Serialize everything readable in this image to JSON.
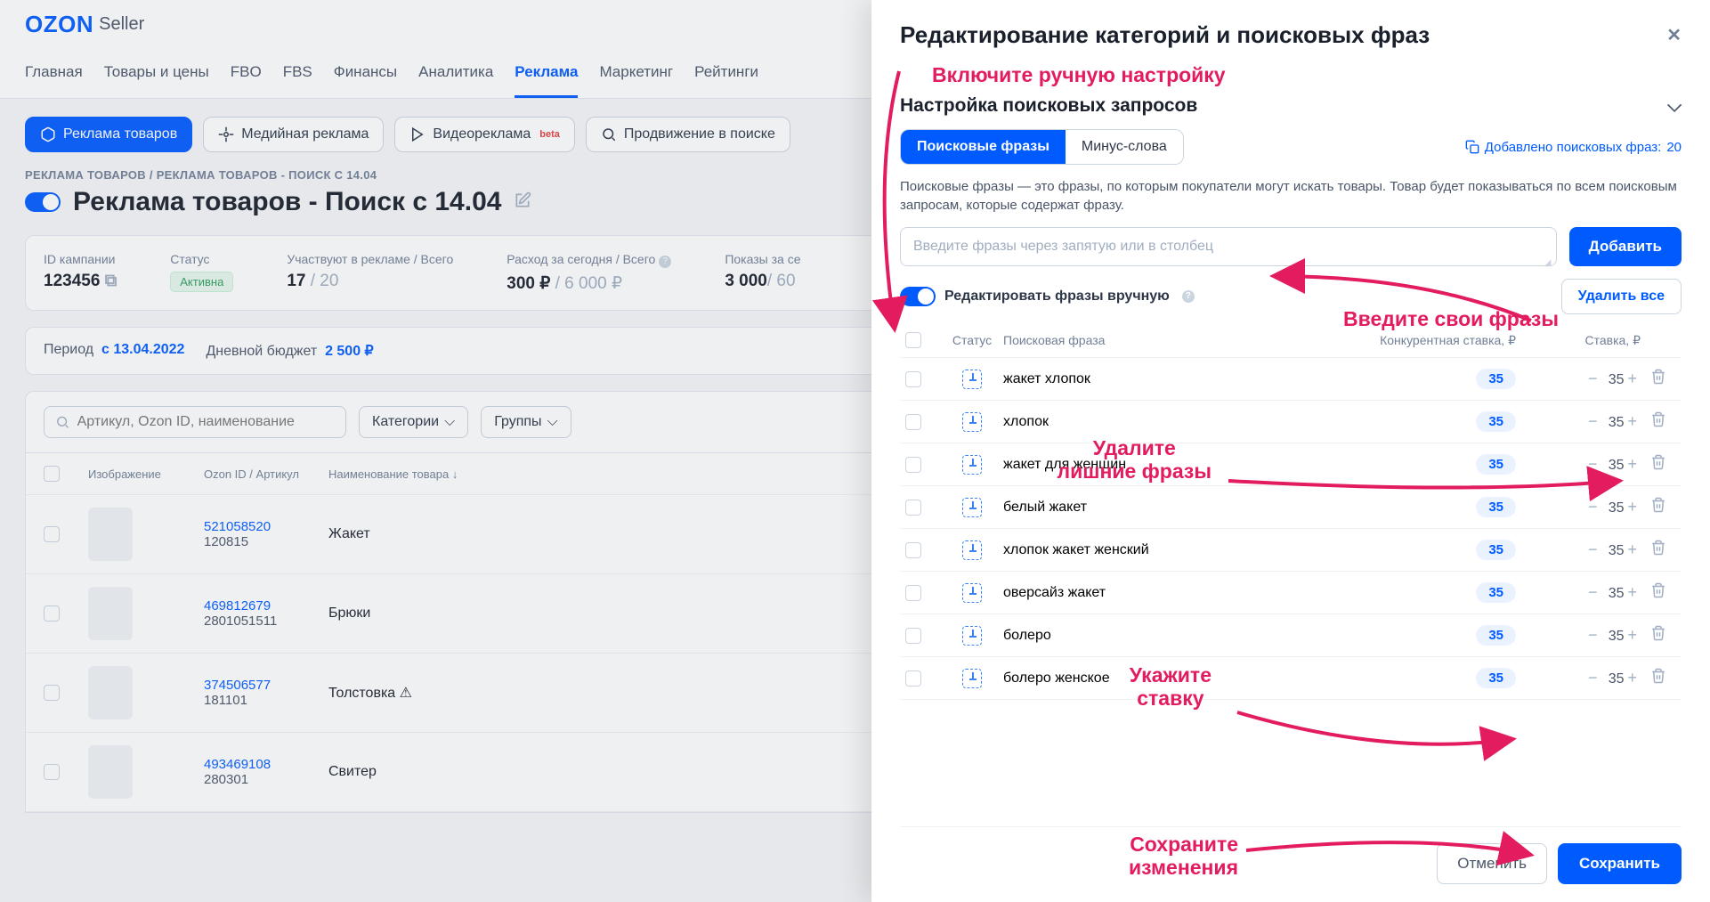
{
  "header": {
    "logo": "OZON",
    "logoSuffix": "Seller"
  },
  "nav": {
    "items": [
      "Главная",
      "Товары и цены",
      "FBO",
      "FBS",
      "Финансы",
      "Аналитика",
      "Реклама",
      "Маркетинг",
      "Рейтинги"
    ],
    "activeIndex": 6
  },
  "subnav": {
    "primary": "Реклама товаров",
    "items": [
      "Медийная реклама",
      "Видеореклама",
      "Продвижение в поиске"
    ],
    "beta": "beta"
  },
  "breadcrumb": "РЕКЛАМА ТОВАРОВ  /  РЕКЛАМА ТОВАРОВ - ПОИСК С 14.04",
  "title": "Реклама товаров - Поиск с 14.04",
  "stats": {
    "campaign": {
      "label": "ID кампании",
      "value": "123456"
    },
    "status": {
      "label": "Статус",
      "badge": "Активна"
    },
    "participation": {
      "label": "Участвуют в рекламе / Всего",
      "value": "17",
      "total": "/ 20"
    },
    "spend": {
      "label": "Расход за сегодня / Всего",
      "value": "300 ₽",
      "total": "/ 6 000 ₽"
    },
    "impressions": {
      "label": "Показы за се",
      "value": "3 000",
      "total": "/ 60"
    }
  },
  "period": {
    "labelPeriod": "Период",
    "valuePeriod": "с 13.04.2022",
    "labelBudget": "Дневной бюджет",
    "valueBudget": "2 500 ₽"
  },
  "filters": {
    "searchPlaceholder": "Артикул, Ozon ID, наименование",
    "categories": "Категории",
    "groups": "Группы"
  },
  "tableHead": {
    "image": "Изображение",
    "ozonId": "Ozon ID / Артикул",
    "name": "Наименование товара"
  },
  "products": [
    {
      "ozonId": "521058520",
      "article": "120815",
      "name": "Жакет"
    },
    {
      "ozonId": "469812679",
      "article": "2801051511",
      "name": "Брюки"
    },
    {
      "ozonId": "374506577",
      "article": "181101",
      "name": "Толстовка ⚠"
    },
    {
      "ozonId": "493469108",
      "article": "280301",
      "name": "Свитер"
    }
  ],
  "panel": {
    "title": "Редактирование категорий и поисковых фраз",
    "sectionTitle": "Настройка поисковых запросов",
    "tabs": {
      "active": "Поисковые фразы",
      "inactive": "Минус-слова"
    },
    "addedLabel": "Добавлено поисковых фраз:",
    "addedCount": "20",
    "description": "Поисковые фразы — это фразы, по которым покупатели могут искать товары. Товар будет показываться по всем поисковым запросам, которые содержат фразу.",
    "inputPlaceholder": "Введите фразы через запятую или в столбец",
    "addBtn": "Добавить",
    "editToggle": "Редактировать фразы вручную",
    "deleteAll": "Удалить все",
    "columns": {
      "status": "Статус",
      "phrase": "Поисковая фраза",
      "compBid": "Конкурентная ставка, ₽",
      "bid": "Ставка, ₽"
    },
    "phrases": [
      {
        "text": "жакет хлопок",
        "comp": "35",
        "bid": "35"
      },
      {
        "text": "хлопок",
        "comp": "35",
        "bid": "35"
      },
      {
        "text": "жакет для женщин",
        "comp": "35",
        "bid": "35"
      },
      {
        "text": "белый жакет",
        "comp": "35",
        "bid": "35"
      },
      {
        "text": "хлопок жакет женский",
        "comp": "35",
        "bid": "35"
      },
      {
        "text": "оверсайз жакет",
        "comp": "35",
        "bid": "35"
      },
      {
        "text": "болеро",
        "comp": "35",
        "bid": "35"
      },
      {
        "text": "болеро женское",
        "comp": "35",
        "bid": "35"
      }
    ],
    "cancel": "Отменить",
    "save": "Сохранить"
  },
  "annotations": {
    "a1": "Включите ручную настройку",
    "a2": "Введите свои фразы",
    "a3": "Удалите лишние фразы",
    "a4": "Укажите ставку",
    "a5": "Сохраните изменения"
  }
}
